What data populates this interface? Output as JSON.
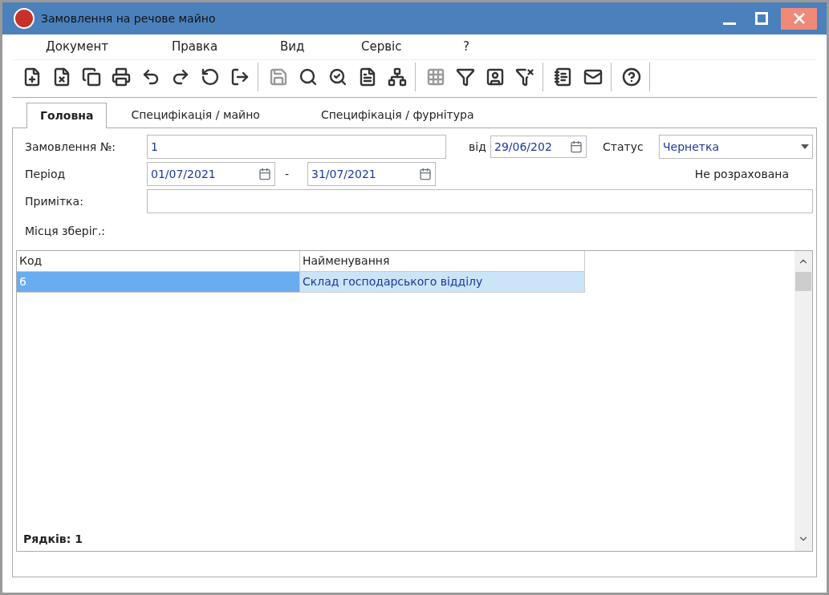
{
  "window": {
    "title": "Замовлення на речове майно"
  },
  "menu": [
    "Документ",
    "Правка",
    "Вид",
    "Сервіс",
    "?"
  ],
  "toolbar": [
    [
      {
        "kind": "new",
        "disabled": false
      },
      {
        "kind": "delete",
        "disabled": false
      },
      {
        "kind": "copy",
        "disabled": false
      },
      {
        "kind": "print",
        "disabled": false
      },
      {
        "kind": "import",
        "disabled": false
      },
      {
        "kind": "export",
        "disabled": false
      },
      {
        "kind": "refresh",
        "disabled": false
      },
      {
        "kind": "exit",
        "disabled": false
      }
    ],
    [
      {
        "kind": "save",
        "disabled": true
      },
      {
        "kind": "search",
        "disabled": false
      },
      {
        "kind": "search-next",
        "disabled": false
      },
      {
        "kind": "person-doc",
        "disabled": false
      },
      {
        "kind": "hierarchy",
        "disabled": false
      }
    ],
    [
      {
        "kind": "grid",
        "disabled": true
      },
      {
        "kind": "filter",
        "disabled": false
      },
      {
        "kind": "filter-person",
        "disabled": false
      },
      {
        "kind": "filter-clear",
        "disabled": false
      }
    ],
    [
      {
        "kind": "notebook",
        "disabled": false
      },
      {
        "kind": "mail",
        "disabled": false
      }
    ],
    [
      {
        "kind": "help",
        "disabled": false
      }
    ]
  ],
  "tabs": [
    {
      "label": "Головна",
      "selected": true
    },
    {
      "label": "Специфікація / майно",
      "selected": false
    },
    {
      "label": "Специфікація / фурнітура",
      "selected": false
    }
  ],
  "form": {
    "order_label": "Замовлення №:",
    "order_value": "1",
    "date_label": "від",
    "date_value": "29/06/202",
    "status_label": "Статус",
    "status_value": "Чернетка",
    "period_label": "Період",
    "period_from": "01/07/2021",
    "period_sep": "-",
    "period_to": "31/07/2021",
    "calc_status": "Не розрахована",
    "note_label": "Примітка:",
    "storage_label": "Місця зберіг.:"
  },
  "table": {
    "columns": [
      "Код",
      "Найменування"
    ],
    "rows": [
      {
        "cells": [
          "6",
          "Склад господарського відділу"
        ],
        "selected": true
      }
    ],
    "footer": "Рядків: 1"
  }
}
